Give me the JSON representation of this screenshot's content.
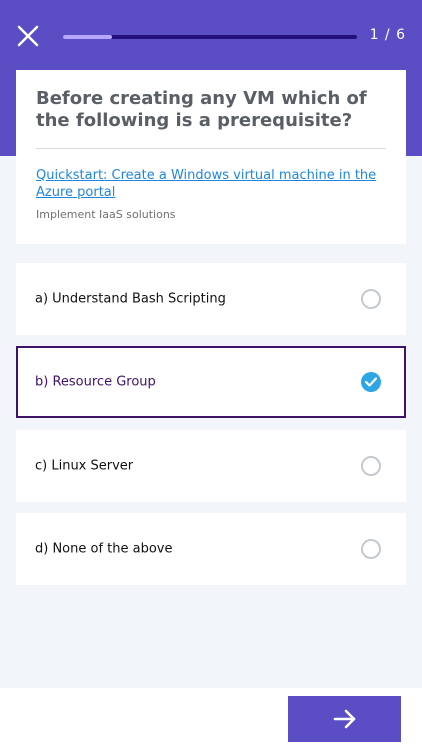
{
  "header": {
    "close_icon": "close-icon",
    "progress_fraction": 0.167,
    "counter": "1 / 6",
    "accent_color": "#5b4dc4"
  },
  "question": {
    "text": "Before creating any VM which of the following is a prerequisite?",
    "reference_link": "Quickstart: Create a Windows virtual machine in the Azure portal",
    "topic": "Implement IaaS solutions"
  },
  "options": [
    {
      "label": "a) Understand Bash Scripting",
      "selected": false
    },
    {
      "label": "b) Resource Group",
      "selected": true
    },
    {
      "label": "c) Linux Server",
      "selected": false
    },
    {
      "label": "d) None of the above",
      "selected": false
    }
  ],
  "footer": {
    "next_icon": "arrow-right-icon"
  }
}
